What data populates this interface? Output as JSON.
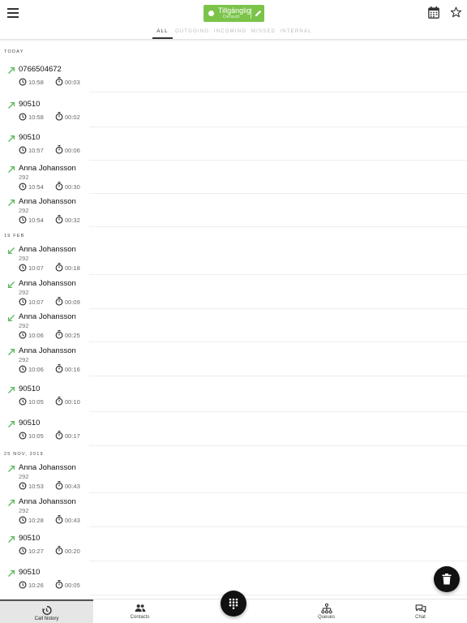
{
  "status": {
    "label": "Tillgänglig",
    "sub": "Default",
    "color": "#7cc34a"
  },
  "tabs": [
    "ALL",
    "OUTGOING",
    "INCOMING",
    "MISSED",
    "INTERNAL"
  ],
  "sections": [
    "TODAY",
    "19 FEB",
    "25 NOV, 2019"
  ],
  "calls": [
    {
      "direction": "outgoing",
      "name": "0766504672",
      "ext": "",
      "time": "10:58",
      "duration": "00:03"
    },
    {
      "direction": "outgoing",
      "name": "90510",
      "ext": "",
      "time": "10:58",
      "duration": "00:02"
    },
    {
      "direction": "outgoing",
      "name": "90510",
      "ext": "",
      "time": "10:57",
      "duration": "00:06"
    },
    {
      "direction": "outgoing",
      "name": "Anna Johansson",
      "ext": "292",
      "time": "10:54",
      "duration": "00:30"
    },
    {
      "direction": "outgoing",
      "name": "Anna Johansson",
      "ext": "292",
      "time": "10:54",
      "duration": "00:32"
    },
    {
      "direction": "incoming",
      "name": "Anna Johansson",
      "ext": "292",
      "time": "10:07",
      "duration": "00:18"
    },
    {
      "direction": "incoming",
      "name": "Anna Johansson",
      "ext": "292",
      "time": "10:07",
      "duration": "00:09"
    },
    {
      "direction": "incoming",
      "name": "Anna Johansson",
      "ext": "292",
      "time": "10:06",
      "duration": "00:25"
    },
    {
      "direction": "outgoing",
      "name": "Anna Johansson",
      "ext": "292",
      "time": "10:06",
      "duration": "00:16"
    },
    {
      "direction": "outgoing",
      "name": "90510",
      "ext": "",
      "time": "10:05",
      "duration": "00:10"
    },
    {
      "direction": "outgoing",
      "name": "90510",
      "ext": "",
      "time": "10:05",
      "duration": "00:17"
    },
    {
      "direction": "outgoing",
      "name": "Anna Johansson",
      "ext": "292",
      "time": "10:53",
      "duration": "00:43"
    },
    {
      "direction": "outgoing",
      "name": "Anna Johansson",
      "ext": "292",
      "time": "10:28",
      "duration": "00:43"
    },
    {
      "direction": "outgoing",
      "name": "90510",
      "ext": "",
      "time": "10:27",
      "duration": "00:20"
    },
    {
      "direction": "outgoing",
      "name": "90510",
      "ext": "",
      "time": "10:26",
      "duration": "00:05"
    }
  ],
  "nav": {
    "call_history": "Call history",
    "contacts": "Contacts",
    "queues": "Queues",
    "chat": "Chat"
  },
  "icons": {
    "direction": "arrow-icon",
    "time": "clock-icon",
    "duration": "timer-icon",
    "delete": "trash-icon",
    "dialpad": "dialpad-icon"
  },
  "colors": {
    "direction_arrow": "#5cb85c"
  }
}
